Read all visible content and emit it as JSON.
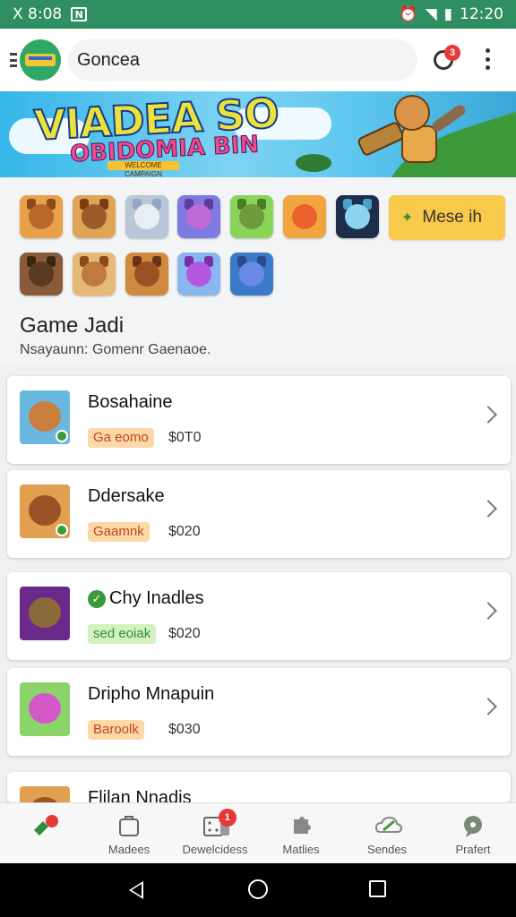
{
  "status_bar": {
    "left_text": "X 8:08",
    "notification_icon": "n-box-icon",
    "time": "12:20"
  },
  "app_bar": {
    "search_text": "Goncea",
    "notification_badge": "3"
  },
  "banner": {
    "title": "VIADEA SO",
    "subtitle": "OBIDOMIA BIN",
    "tag": "WELCOME CAMPAIGN"
  },
  "grid": {
    "more_button_label": "Mese ih",
    "icons": [
      {
        "bg": "#e9a04a",
        "face": "#b9672b",
        "ear": "#8a4a1a"
      },
      {
        "bg": "#dfa456",
        "face": "#9a5a2a",
        "ear": "#7a3e12"
      },
      {
        "bg": "#b9c6d8",
        "face": "#e8eef6",
        "ear": "#93a6c4"
      },
      {
        "bg": "#7e7ae0",
        "face": "#c06ad8",
        "ear": "#5a3e9a"
      },
      {
        "bg": "#8bd45a",
        "face": "#6f9b3e",
        "ear": "#4a7a22"
      },
      {
        "bg": "#f0a540",
        "face": "#e9622c",
        "ear": "#f0a540"
      },
      {
        "bg": "#1d2e4a",
        "face": "#8ad4f2",
        "ear": "#4aa0c8"
      },
      {
        "bg": "#8a5a3a",
        "face": "#5a3a22",
        "ear": "#3a2412"
      },
      {
        "bg": "#e8b878",
        "face": "#c07a3e",
        "ear": "#8a4a1a"
      },
      {
        "bg": "#d08a3e",
        "face": "#9a5224",
        "ear": "#6a3412"
      },
      {
        "bg": "#8ab6f0",
        "face": "#b458e0",
        "ear": "#7a2ea8"
      },
      {
        "bg": "#3a7ac8",
        "face": "#6a8ae8",
        "ear": "#2a4a8a"
      }
    ]
  },
  "section": {
    "title": "Game Jadi",
    "subtitle": "Nsayaunn: Gomenr Gaenaoe."
  },
  "list": [
    {
      "title": "Bosahaine",
      "tag": "Ga eomo",
      "tag_bg": "#fcd8a8",
      "tag_color": "#c0461a",
      "price": "$0T0",
      "thumb_bg": "#6ab8e0",
      "thumb_face": "#c9803e",
      "check": false
    },
    {
      "title": "Ddersake",
      "tag": "Gaamnk",
      "tag_bg": "#fcd8a8",
      "tag_color": "#c0461a",
      "price": "$020",
      "thumb_bg": "#e0a050",
      "thumb_face": "#9a5224",
      "check": false
    },
    {
      "title": "Chy Inadles",
      "tag": "sed eoiak",
      "tag_bg": "#d4f2c0",
      "tag_color": "#2f8f3a",
      "price": "$020",
      "thumb_bg": "#6a2a8a",
      "thumb_face": "#8a6a3a",
      "check": true
    },
    {
      "title": "Dripho Mnapuin",
      "tag": "Baroolk",
      "tag_bg": "#fcd8a8",
      "tag_color": "#c0461a",
      "price": "$030",
      "thumb_bg": "#8ad46a",
      "thumb_face": "#d458c8",
      "check": false
    },
    {
      "title": "Flilan Nnadis",
      "tag": "",
      "tag_bg": "#fcd8a8",
      "tag_color": "#c0461a",
      "price": "",
      "thumb_bg": "#e0a050",
      "thumb_face": "#9a5224",
      "check": false
    }
  ],
  "bottom_nav": [
    {
      "label": "",
      "icon": "controller-icon",
      "badge": ""
    },
    {
      "label": "Madees",
      "icon": "bag-icon",
      "badge": ""
    },
    {
      "label": "Dewelcidess",
      "icon": "dice-icon",
      "badge": "1"
    },
    {
      "label": "Matlies",
      "icon": "puzzle-icon",
      "badge": ""
    },
    {
      "label": "Sendes",
      "icon": "cloud-icon",
      "badge": ""
    },
    {
      "label": "Prafert",
      "icon": "chat-icon",
      "badge": ""
    }
  ]
}
